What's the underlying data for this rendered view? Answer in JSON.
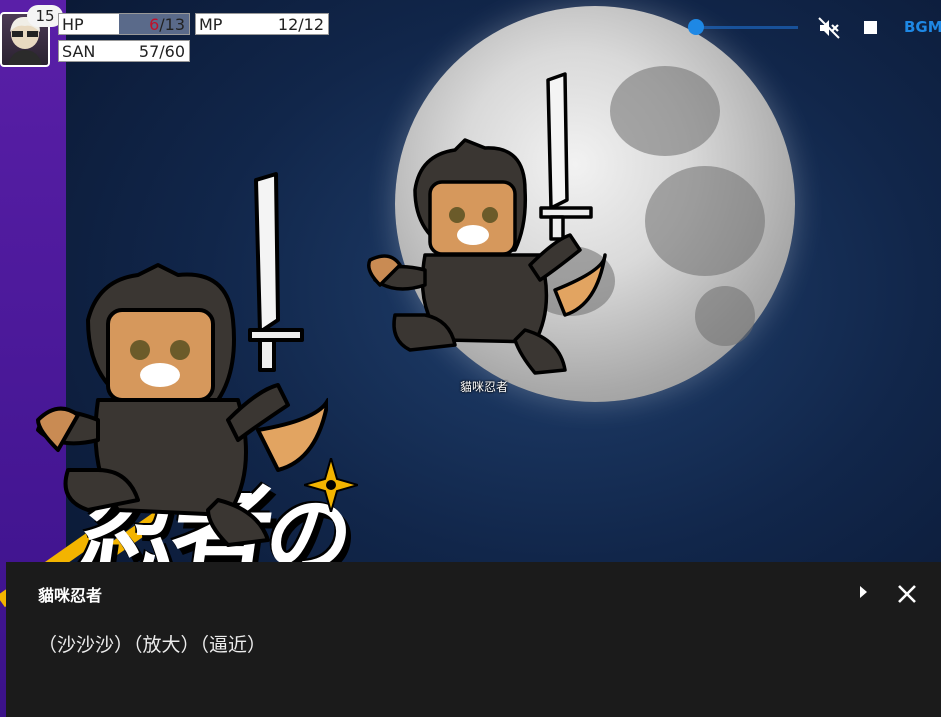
{
  "hud": {
    "level": "15",
    "hp": {
      "label": "HP",
      "current": "6",
      "max": "/13",
      "fraction": 0.46
    },
    "mp": {
      "label": "MP",
      "value": "12/12",
      "fraction": 1.0
    },
    "san": {
      "label": "SAN",
      "value": "57/60",
      "fraction": 0.95
    }
  },
  "audio": {
    "volume_fraction": 0.0,
    "bgm_label": "BGM"
  },
  "scene": {
    "cat_label": "貓咪忍者",
    "title_text": "忍者",
    "title_suffix": "の"
  },
  "dialog": {
    "speaker": "貓咪忍者",
    "text": "（沙沙沙）（放大）（逼近）"
  },
  "colors": {
    "accent": "#1e88e5",
    "hp_low": "#c0102a",
    "dialog_bg": "#1b1b1b"
  }
}
